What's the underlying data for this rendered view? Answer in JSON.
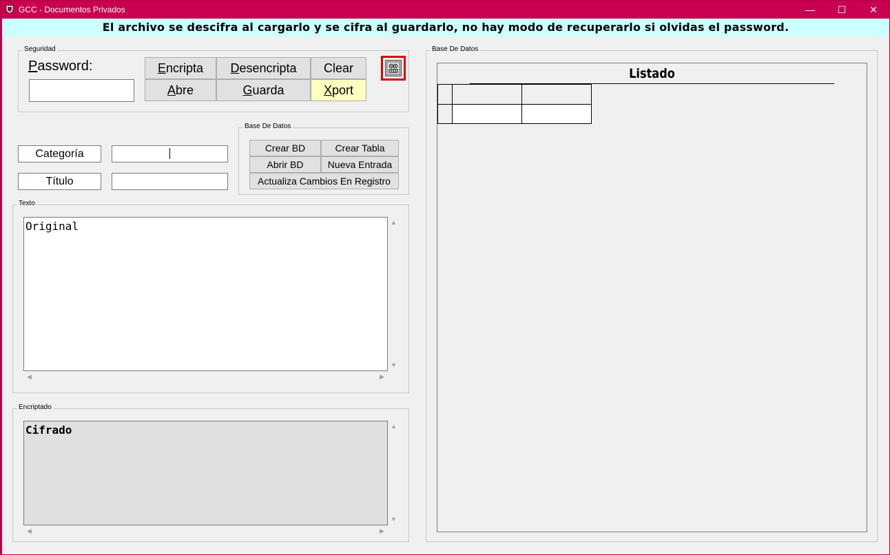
{
  "window": {
    "title": "GCC - Documentos Privados",
    "minimize": "—",
    "maximize": "☐",
    "close": "✕"
  },
  "banner": "El archivo se descifra al cargarlo y se cifra al guardarlo, no hay modo de recuperarlo si olvidas el password.",
  "seguridad": {
    "legend": "Seguridad",
    "password_label_first": "P",
    "password_label_rest": "assword:",
    "password_value": "",
    "buttons": {
      "encripta_first": "E",
      "encripta_rest": "ncripta",
      "desencripta_first": "D",
      "desencripta_rest": "esencripta",
      "clear": "Clear",
      "abre_first": "A",
      "abre_rest": "bre",
      "guarda_first": "G",
      "guarda_rest": "uarda",
      "xport_first": "X",
      "xport_rest": "port"
    },
    "face_icon": "face-icon"
  },
  "fields": {
    "categoria_label": "Categoría",
    "categoria_value": "",
    "titulo_label": "Título",
    "titulo_value": ""
  },
  "base_datos_small": {
    "legend": "Base De Datos",
    "crear_bd": "Crear BD",
    "crear_tabla": "Crear Tabla",
    "abrir_bd": "Abrir BD",
    "nueva_entrada": "Nueva Entrada",
    "actualiza": "Actualiza Cambios En Registro"
  },
  "texto": {
    "legend": "Texto",
    "content": "Original"
  },
  "encriptado": {
    "legend": "Encriptado",
    "content": "Cifrado"
  },
  "base_datos_panel": {
    "legend": "Base De Datos",
    "listado_title": "Listado"
  },
  "colors": {
    "titlebar": "#c8004f",
    "banner": "#ccffff",
    "xport": "#ffffc0",
    "face_border": "#e00000"
  }
}
